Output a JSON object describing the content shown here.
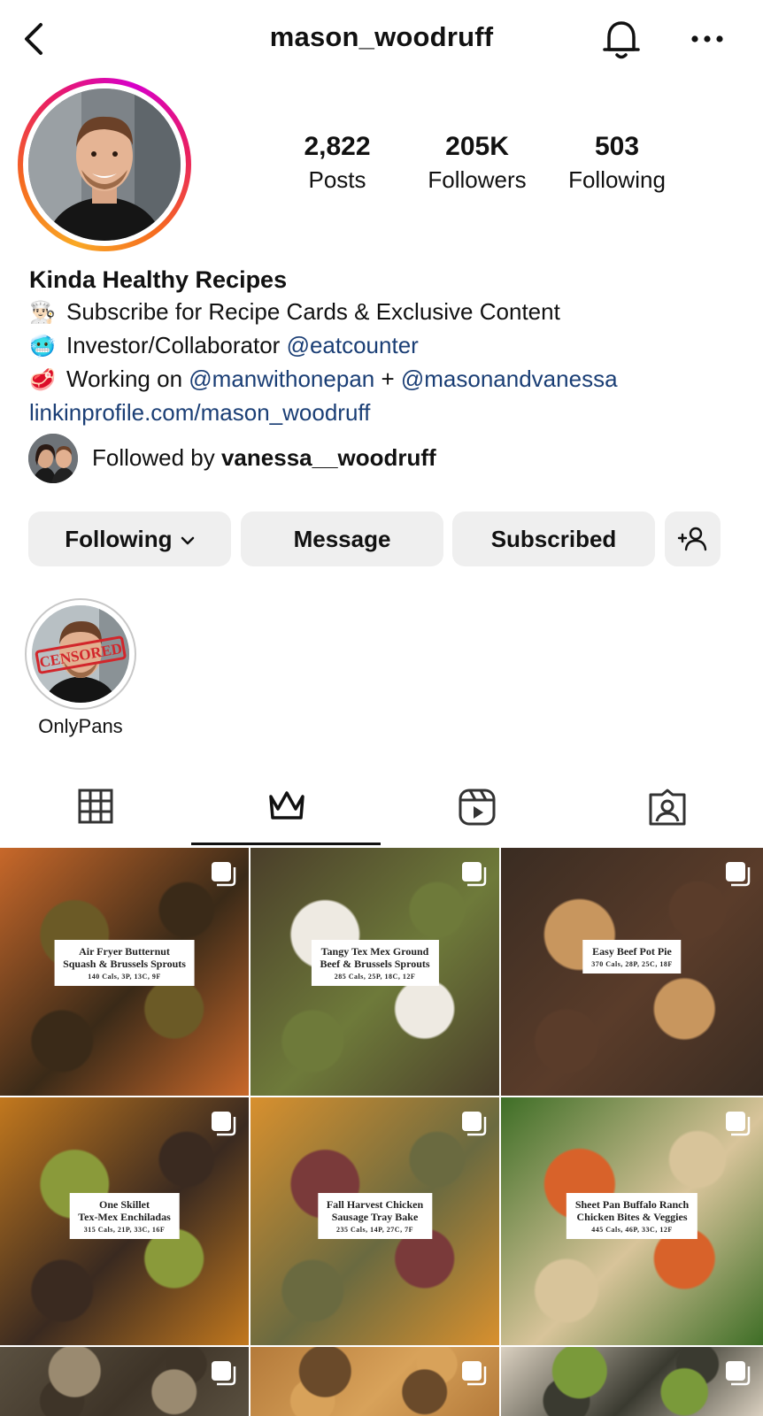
{
  "header": {
    "username": "mason_woodruff"
  },
  "profile": {
    "stats": [
      {
        "value": "2,822",
        "label": "Posts"
      },
      {
        "value": "205K",
        "label": "Followers"
      },
      {
        "value": "503",
        "label": "Following"
      }
    ],
    "display_name": "Kinda Healthy Recipes",
    "bio": {
      "line1": {
        "emoji": "👨🏻‍🍳",
        "text": "Subscribe for Recipe Cards & Exclusive Content"
      },
      "line2": {
        "emoji": "🥶",
        "text": "Investor/Collaborator ",
        "mention": "@eatcounter"
      },
      "line3": {
        "emoji": "🥩",
        "text": "Working on ",
        "mention1": "@manwithonepan",
        "plus": " + ",
        "mention2": "@masonandvanessa"
      }
    },
    "link": "linkinprofile.com/mason_woodruff",
    "followed_by": {
      "prefix": "Followed by ",
      "user": "vanessa__woodruff"
    }
  },
  "actions": {
    "following": "Following",
    "message": "Message",
    "subscribed": "Subscribed"
  },
  "highlights": [
    {
      "label": "OnlyPans",
      "stamp": "CENSORED"
    }
  ],
  "tabs": [
    {
      "name": "grid",
      "icon": "grid-icon"
    },
    {
      "name": "subscriber",
      "icon": "crown-icon",
      "active": true
    },
    {
      "name": "reels",
      "icon": "reels-icon"
    },
    {
      "name": "tagged",
      "icon": "tagged-icon"
    }
  ],
  "posts": [
    {
      "title": "Air Fryer Butternut\nSquash & Brussels Sprouts",
      "macros": "140 Cals, 3P, 13C, 9F",
      "colors": [
        "#c8682a",
        "#6b5a26",
        "#3a2a18"
      ]
    },
    {
      "title": "Tangy Tex Mex Ground\nBeef & Brussels Sprouts",
      "macros": "285 Cals, 25P, 18C, 12F",
      "colors": [
        "#4a3e2a",
        "#eeeae2",
        "#6e7a3a"
      ]
    },
    {
      "title": "Easy Beef Pot Pie",
      "macros": "370 Cals, 28P, 25C, 18F",
      "colors": [
        "#3a2c22",
        "#c8965e",
        "#5a3c2a"
      ]
    },
    {
      "title": "One Skillet\nTex-Mex Enchiladas",
      "macros": "315 Cals, 21P, 33C, 16F",
      "colors": [
        "#c2781e",
        "#8a9a3a",
        "#3a2a20"
      ]
    },
    {
      "title": "Fall Harvest Chicken\nSausage Tray Bake",
      "macros": "235 Cals, 14P, 27C, 7F",
      "colors": [
        "#d8902e",
        "#7a3a3a",
        "#6a6a40"
      ]
    },
    {
      "title": "Sheet Pan Buffalo Ranch\nChicken Bites & Veggies",
      "macros": "445 Cals, 46P, 33C, 12F",
      "colors": [
        "#3e6e26",
        "#d8622a",
        "#d8c49a"
      ]
    },
    {
      "title": "",
      "macros": "",
      "colors": [
        "#5a5040",
        "#9a8a70",
        "#3e3428"
      ]
    },
    {
      "title": "",
      "macros": "",
      "colors": [
        "#b47a3a",
        "#6a4a2a",
        "#d8a25a"
      ]
    },
    {
      "title": "",
      "macros": "",
      "colors": [
        "#dad0c0",
        "#7a9a3a",
        "#3a3a30"
      ]
    }
  ]
}
